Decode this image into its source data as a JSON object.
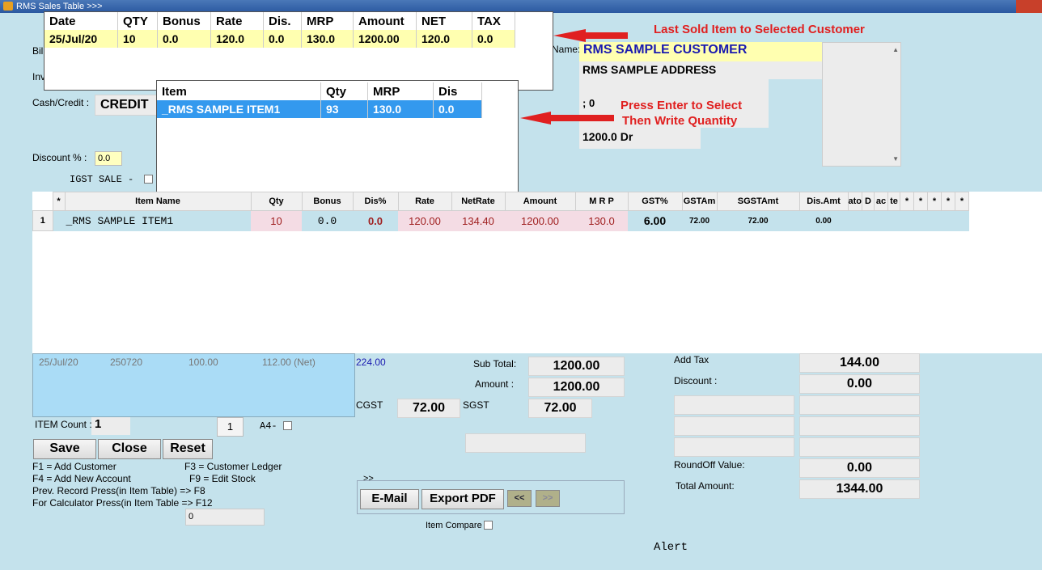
{
  "window": {
    "title": "RMS Sales Table >>>"
  },
  "form": {
    "bill_label": "Bil",
    "inv_label": "Inv",
    "cash_credit_label": "Cash/Credit :",
    "cash_credit_value": "CREDIT",
    "discount_label": "Discount % :",
    "discount_value": "0.0",
    "igst_label": "IGST SALE -",
    "name_label": "Name:"
  },
  "customer": {
    "name": "RMS SAMPLE CUSTOMER",
    "address": "RMS SAMPLE ADDRESS",
    "line3": "; 0",
    "balance": "1200.0 Dr"
  },
  "last_sold": {
    "headers": [
      "Date",
      "QTY",
      "Bonus",
      "Rate",
      "Dis.",
      "MRP",
      "Amount",
      "NET",
      "TAX"
    ],
    "row": [
      "25/Jul/20",
      "10",
      "0.0",
      "120.0",
      "0.0",
      "130.0",
      "1200.00",
      "120.0",
      "0.0"
    ]
  },
  "item_popup": {
    "headers": [
      "Item",
      "Qty",
      "MRP",
      "Dis"
    ],
    "row": [
      "_RMS SAMPLE ITEM1",
      "93",
      "130.0",
      "0.0"
    ]
  },
  "annotations": {
    "last_sold": "Last Sold Item to Selected Customer",
    "press_enter_1": "Press Enter to Select",
    "press_enter_2": "Then Write Quantity"
  },
  "grid": {
    "headers": [
      "*",
      "Item Name",
      "Qty",
      "Bonus",
      "Dis%",
      "Rate",
      "NetRate",
      "Amount",
      "M R P",
      "GST%",
      "GSTAm",
      "SGSTAmt",
      "Dis.Amt",
      "ato",
      "D",
      "ac",
      "te",
      "*",
      "*",
      "*",
      "*",
      "*"
    ],
    "row": {
      "num": "1",
      "item_name": "_RMS SAMPLE ITEM1",
      "qty": "10",
      "bonus": "0.0",
      "dis": "0.0",
      "rate": "120.00",
      "netrate": "134.40",
      "amount": "1200.00",
      "mrp": "130.0",
      "gst": "6.00",
      "gstam": "72.00",
      "sgstamt": "72.00",
      "disamt": "0.00"
    }
  },
  "history": {
    "date": "25/Jul/20",
    "code": "250720",
    "val1": "100.00",
    "val2": "112.00 (Net)",
    "val3": "224.00"
  },
  "totals_mid": {
    "subtotal_label": "Sub Total:",
    "subtotal": "1200.00",
    "amount_label": "Amount :",
    "amount": "1200.00",
    "cgst_label": "CGST",
    "cgst": "72.00",
    "sgst_label": "SGST",
    "sgst": "72.00"
  },
  "totals_right": {
    "addtax_label": "Add Tax",
    "addtax": "144.00",
    "discount_label": "Discount :",
    "discount": "0.00",
    "roundoff_label": "RoundOff Value:",
    "roundoff": "0.00",
    "total_label": "Total Amount:",
    "total": "1344.00"
  },
  "footer": {
    "item_count_label": "ITEM Count :",
    "item_count": "1",
    "page_box": "1",
    "a4_label": "A4-",
    "save": "Save",
    "close": "Close",
    "reset": "Reset",
    "help": [
      "F1 = Add Customer",
      "F3 = Customer Ledger",
      "F4 = Add New Account",
      "F9 = Edit Stock",
      "Prev. Record Press(in Item Table)  => F8",
      "For Calculator Press(in Item Table  => F12"
    ],
    "calc_value": "0",
    "group_label": ">>",
    "email": "E-Mail",
    "export_pdf": "Export PDF",
    "prev": "<<",
    "next": ">>",
    "item_compare": "Item Compare",
    "alert": "Alert"
  }
}
